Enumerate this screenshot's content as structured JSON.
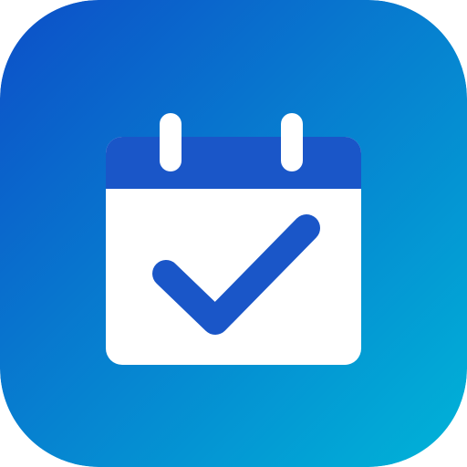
{
  "icon": {
    "name": "calendar-check-icon",
    "colors": {
      "gradient_start": "#0d52c9",
      "gradient_end": "#00b3d6",
      "calendar_header": "#1a56c8",
      "calendar_body": "#ffffff",
      "checkmark": "#1a56c8",
      "rings": "#ffffff"
    }
  }
}
